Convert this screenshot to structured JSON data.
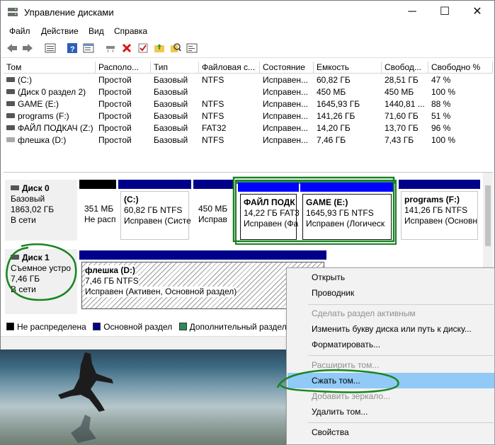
{
  "window": {
    "title": "Управление дисками",
    "minimize": "─",
    "maximize": "☐",
    "close": "✕"
  },
  "menu": [
    "Файл",
    "Действие",
    "Вид",
    "Справка"
  ],
  "toolbar_icons": [
    "back-icon",
    "forward-icon",
    "list-view-icon",
    "help-icon",
    "properties-icon",
    "connect-icon",
    "delete-icon",
    "check-icon",
    "folder-up-icon",
    "search-icon",
    "console-icon"
  ],
  "table": {
    "columns": [
      "Том",
      "Располо...",
      "Тип",
      "Файловая с...",
      "Состояние",
      "Емкость",
      "Свобод...",
      "Свободно %"
    ],
    "rows": [
      {
        "vol": "(C:)",
        "layout": "Простой",
        "type": "Базовый",
        "fs": "NTFS",
        "status": "Исправен...",
        "cap": "60,82 ГБ",
        "free": "28,51 ГБ",
        "pct": "47 %"
      },
      {
        "vol": "(Диск 0 раздел 2)",
        "layout": "Простой",
        "type": "Базовый",
        "fs": "",
        "status": "Исправен...",
        "cap": "450 МБ",
        "free": "450 МБ",
        "pct": "100 %"
      },
      {
        "vol": "GAME (E:)",
        "layout": "Простой",
        "type": "Базовый",
        "fs": "NTFS",
        "status": "Исправен...",
        "cap": "1645,93 ГБ",
        "free": "1440,81 ...",
        "pct": "88 %"
      },
      {
        "vol": "programs (F:)",
        "layout": "Простой",
        "type": "Базовый",
        "fs": "NTFS",
        "status": "Исправен...",
        "cap": "141,26 ГБ",
        "free": "71,60 ГБ",
        "pct": "51 %"
      },
      {
        "vol": "ФАЙЛ ПОДКАЧ (Z:)",
        "layout": "Простой",
        "type": "Базовый",
        "fs": "FAT32",
        "status": "Исправен...",
        "cap": "14,20 ГБ",
        "free": "13,70 ГБ",
        "pct": "96 %"
      },
      {
        "vol": "флешка (D:)",
        "layout": "Простой",
        "type": "Базовый",
        "fs": "NTFS",
        "status": "Исправен...",
        "cap": "7,46 ГБ",
        "free": "7,43 ГБ",
        "pct": "100 %"
      }
    ]
  },
  "disk0": {
    "name": "Диск 0",
    "type": "Базовый",
    "size": "1863,02 ГБ",
    "state": "В сети",
    "partitions": [
      {
        "name": "",
        "line1": "351 МБ",
        "line2": "Не расп"
      },
      {
        "name": "(C:)",
        "line1": "60,82 ГБ NTFS",
        "line2": "Исправен (Систе"
      },
      {
        "name": "",
        "line1": "450 МБ",
        "line2": "Исправ"
      },
      {
        "name": "ФАЙЛ ПОДК",
        "line1": "14,22 ГБ FAT3",
        "line2": "Исправен (Фа"
      },
      {
        "name": "GAME  (E:)",
        "line1": "1645,93 ГБ NTFS",
        "line2": "Исправен (Логическ"
      },
      {
        "name": "programs  (F:)",
        "line1": "141,26 ГБ NTFS",
        "line2": "Исправен (Основн"
      }
    ]
  },
  "disk1": {
    "name": "Диск 1",
    "type": "Съемное устро",
    "size": "7,46 ГБ",
    "state": "В сети",
    "partition": {
      "name": "флешка  (D:)",
      "line1": "7,46 ГБ NTFS",
      "line2": "Исправен (Активен, Основной раздел)"
    }
  },
  "legend": [
    "Не распределена",
    "Основной раздел",
    "Дополнительный раздел"
  ],
  "colors": {
    "unallocated": "#000000",
    "primary": "#00008b",
    "extended": "#2e8b57",
    "logical": "#0000ff",
    "annotation": "#17851f",
    "highlight": "#91c9f7"
  },
  "context_menu": {
    "items": [
      {
        "label": "Открыть",
        "enabled": true
      },
      {
        "label": "Проводник",
        "enabled": true
      },
      {
        "label": "Сделать раздел активным",
        "enabled": false
      },
      {
        "label": "Изменить букву диска или путь к диску...",
        "enabled": true
      },
      {
        "label": "Форматировать...",
        "enabled": true
      },
      {
        "label": "Расширить том...",
        "enabled": false
      },
      {
        "label": "Сжать том...",
        "enabled": true,
        "highlighted": true
      },
      {
        "label": "Добавить зеркало...",
        "enabled": false
      },
      {
        "label": "Удалить том...",
        "enabled": true
      },
      {
        "label": "Свойства",
        "enabled": true
      }
    ]
  }
}
